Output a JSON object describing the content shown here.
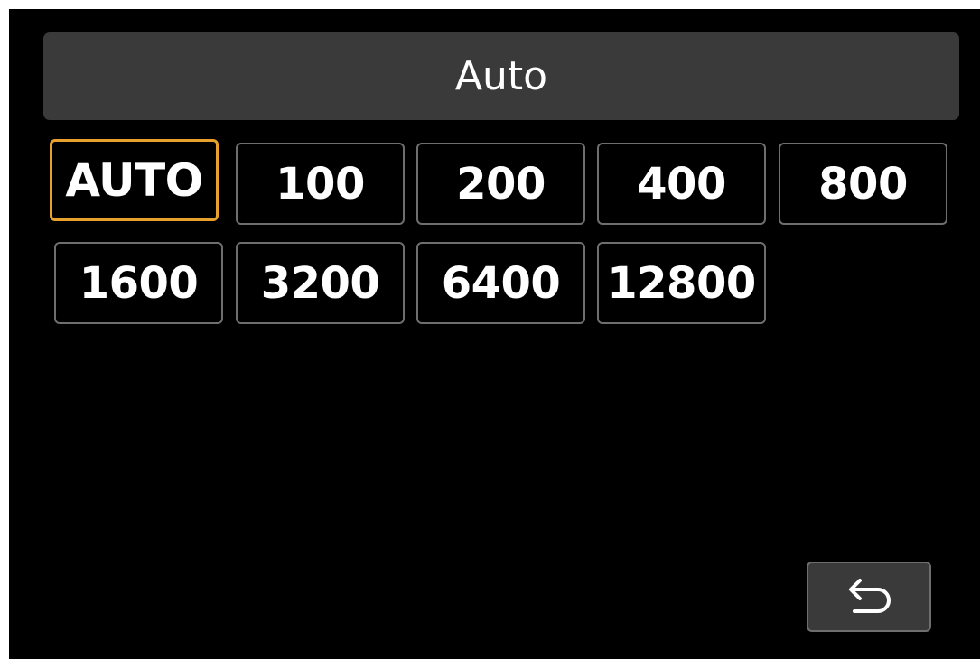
{
  "header": {
    "title": "Auto"
  },
  "iso_options": [
    {
      "label": "AUTO",
      "selected": true
    },
    {
      "label": "100",
      "selected": false
    },
    {
      "label": "200",
      "selected": false
    },
    {
      "label": "400",
      "selected": false
    },
    {
      "label": "800",
      "selected": false
    },
    {
      "label": "1600",
      "selected": false
    },
    {
      "label": "3200",
      "selected": false
    },
    {
      "label": "6400",
      "selected": false
    },
    {
      "label": "12800",
      "selected": false
    }
  ],
  "back_button": {
    "icon": "return-arrow-icon"
  },
  "colors": {
    "background": "#000000",
    "header_bg": "#3a3a3a",
    "button_border": "#6e6e6e",
    "selected_border": "#e8a12c",
    "text": "#ffffff"
  }
}
